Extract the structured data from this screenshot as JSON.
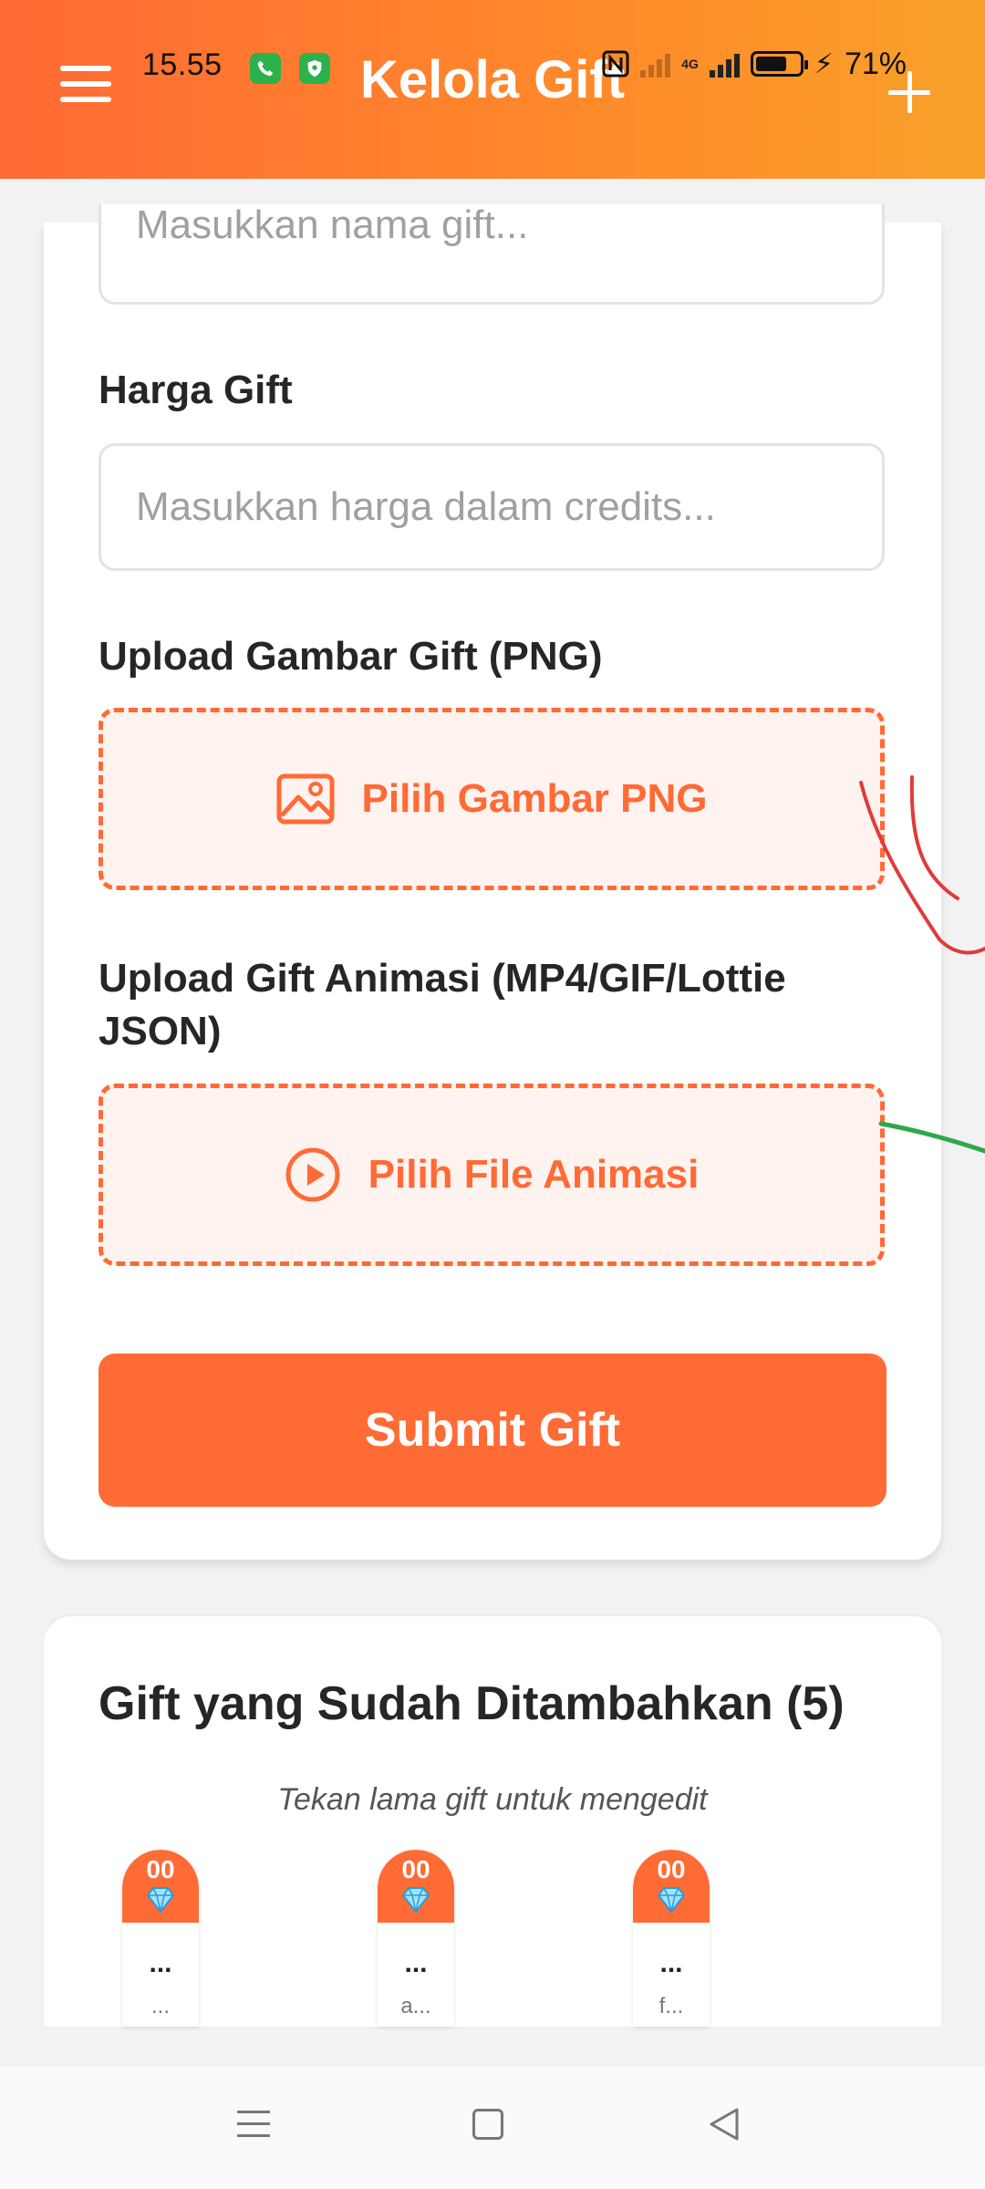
{
  "status_bar": {
    "time": "15.55",
    "network": "4G",
    "battery": "71%",
    "battery_level": 0.71
  },
  "header": {
    "title": "Kelola Gift",
    "menu_icon": "hamburger-menu-icon",
    "add_icon": "plus-icon"
  },
  "form": {
    "name_placeholder": "Masukkan nama gift...",
    "price_label": "Harga Gift",
    "price_placeholder": "Masukkan harga dalam credits...",
    "image_label": "Upload Gambar Gift (PNG)",
    "image_button": "Pilih Gambar PNG",
    "image_icon": "image-icon",
    "animation_label": "Upload Gift Animasi (MP4/GIF/Lottie JSON)",
    "animation_button": "Pilih File Animasi",
    "animation_icon": "play-circle-icon",
    "submit_label": "Submit Gift"
  },
  "gift_list": {
    "title": "Gift yang Sudah Ditambahkan (5)",
    "hint": "Tekan lama gift untuk mengedit",
    "items": [
      {
        "price": "00",
        "name": "...",
        "sub": "..."
      },
      {
        "price": "00",
        "name": "...",
        "sub": "a..."
      },
      {
        "price": "00",
        "name": "...",
        "sub": "f..."
      }
    ]
  },
  "colors": {
    "accent": "#ff6b35",
    "header_gradient_end": "#f9a12a",
    "upload_bg": "#fff3f0"
  }
}
